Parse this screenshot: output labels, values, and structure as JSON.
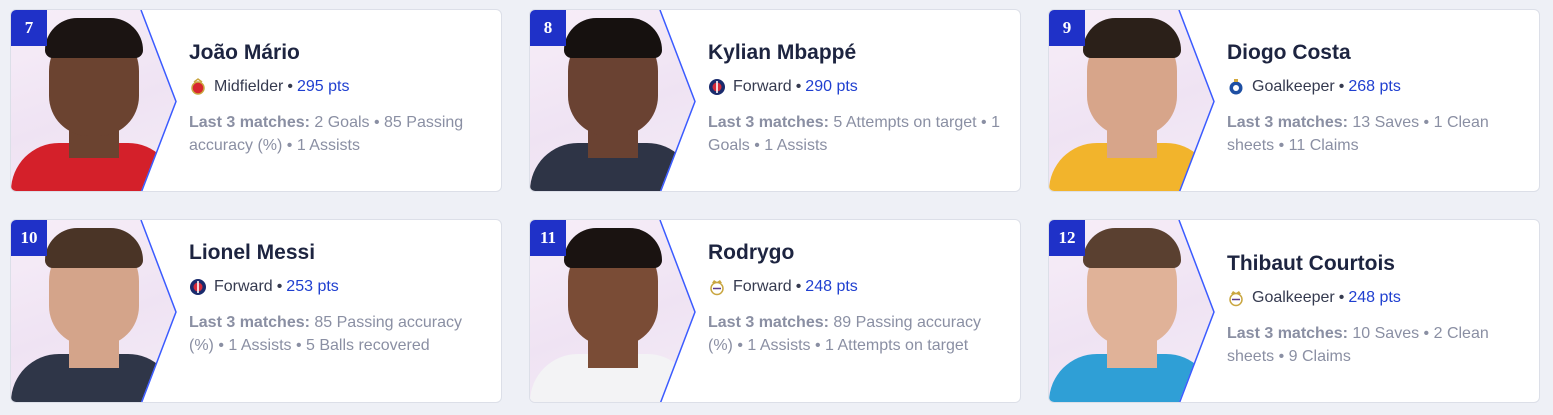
{
  "cards": [
    {
      "rank": "7",
      "name": "João Mário",
      "position": "Midfielder",
      "points": "295 pts",
      "stats_label": "Last 3 matches:",
      "stats": "2 Goals • 85 Passing accuracy (%) • 1 Assists",
      "club_icon": "benfica-crest-icon",
      "skin": "#6b4330",
      "hair": "#1b1412",
      "shirt": "#d4202a"
    },
    {
      "rank": "8",
      "name": "Kylian Mbappé",
      "position": "Forward",
      "points": "290 pts",
      "stats_label": "Last 3 matches:",
      "stats": "5 Attempts on target • 1 Goals • 1 Assists",
      "club_icon": "psg-crest-icon",
      "skin": "#6a4232",
      "hair": "#16110f",
      "shirt": "#2e3446"
    },
    {
      "rank": "9",
      "name": "Diogo Costa",
      "position": "Goalkeeper",
      "points": "268 pts",
      "stats_label": "Last 3 matches:",
      "stats": "13 Saves • 1 Clean sheets • 11 Claims",
      "club_icon": "porto-crest-icon",
      "skin": "#d7a58a",
      "hair": "#2b2019",
      "shirt": "#f2b42c"
    },
    {
      "rank": "10",
      "name": "Lionel Messi",
      "position": "Forward",
      "points": "253 pts",
      "stats_label": "Last 3 matches:",
      "stats": "85 Passing accuracy (%) • 1 Assists • 5 Balls recovered",
      "club_icon": "psg-crest-icon",
      "skin": "#d4a48a",
      "hair": "#4a3426",
      "shirt": "#2f3648"
    },
    {
      "rank": "11",
      "name": "Rodrygo",
      "position": "Forward",
      "points": "248 pts",
      "stats_label": "Last 3 matches:",
      "stats": "89 Passing accuracy (%) • 1 Assists • 1 Attempts on target",
      "club_icon": "real-madrid-crest-icon",
      "skin": "#7a4c36",
      "hair": "#1a1311",
      "shirt": "#f3f3f5"
    },
    {
      "rank": "12",
      "name": "Thibaut Courtois",
      "position": "Goalkeeper",
      "points": "248 pts",
      "stats_label": "Last 3 matches:",
      "stats": "10 Saves • 2 Clean sheets • 9 Claims",
      "club_icon": "real-madrid-crest-icon",
      "skin": "#e0b298",
      "hair": "#5a4030",
      "shirt": "#2f9fd6"
    }
  ]
}
